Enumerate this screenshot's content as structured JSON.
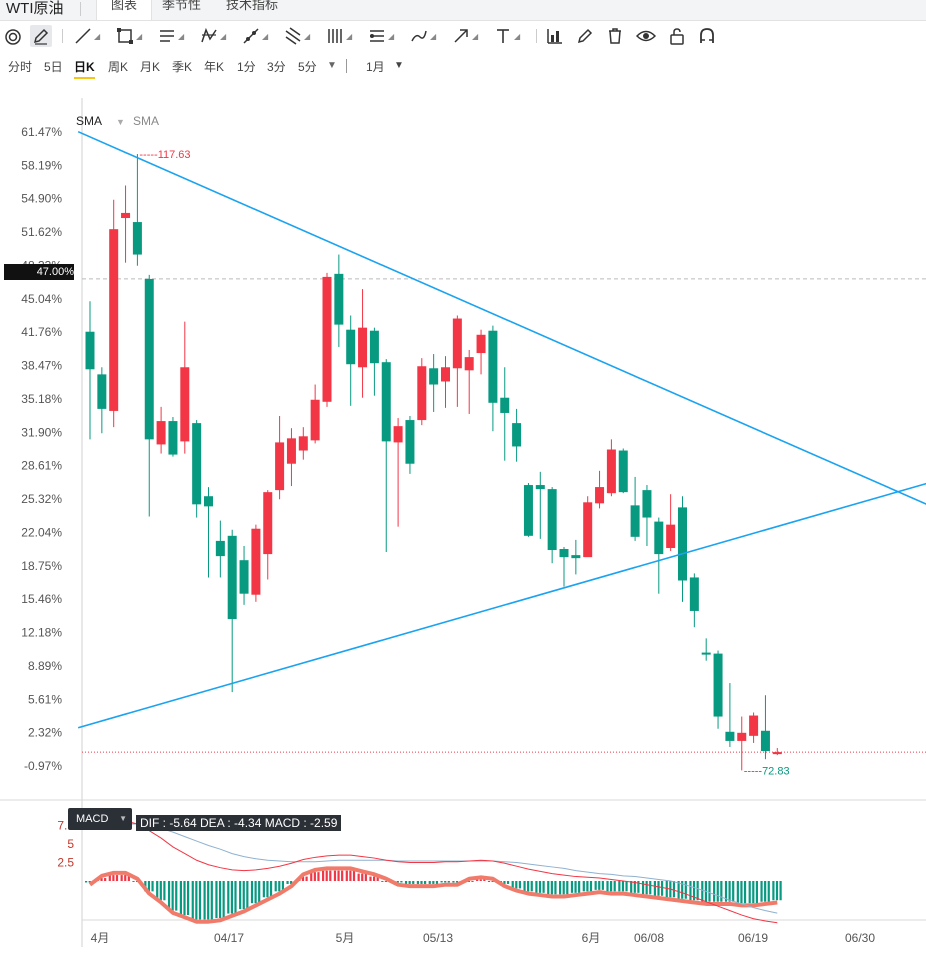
{
  "tabs": {
    "title": "WTI原油",
    "items": [
      "图表",
      "季节性",
      "技术指标"
    ],
    "active": 0
  },
  "toolbar": {
    "icons": [
      "target-icon",
      "pen-icon",
      "line-icon",
      "rect-icon",
      "hlines-icon",
      "pattern-icon",
      "crossline-icon",
      "parallel-icon",
      "fib-icon",
      "channel-icon",
      "brush-icon",
      "arrow-icon",
      "text-icon",
      "barchart-icon",
      "edit-icon",
      "trash-icon",
      "eye-icon",
      "lock-icon",
      "magnet-icon"
    ]
  },
  "periods": {
    "items": [
      "分时",
      "5日",
      "日K",
      "周K",
      "月K",
      "季K",
      "年K",
      "1分",
      "3分",
      "5分"
    ],
    "active": "日K",
    "more": "▼",
    "range": "1月",
    "range_caret": "▼"
  },
  "legend": {
    "sma1": "SMA",
    "sma2": "SMA"
  },
  "price_tag": "47.00%",
  "annotations": {
    "high": "117.63",
    "low": "72.83"
  },
  "macd": {
    "button": "MACD",
    "info": "DIF : -5.64  DEA : -4.34  MACD : -2.59",
    "ticks": [
      "7.5",
      "5",
      "2.5"
    ]
  },
  "colors": {
    "up": "#f23645",
    "down": "#089981",
    "trend": "#1aa3f0",
    "macd_hist": "#089981",
    "macd_hist_up": "#f23645",
    "macd_line": "#f07b6b",
    "dea": "#8fb1cf"
  },
  "chart_data": {
    "type": "candlestick",
    "y_axis_unit": "percent change",
    "y_ticks": [
      "61.47%",
      "58.19%",
      "54.90%",
      "51.62%",
      "48.33%",
      "45.04%",
      "41.76%",
      "38.47%",
      "35.18%",
      "31.90%",
      "28.61%",
      "25.32%",
      "22.04%",
      "18.75%",
      "15.46%",
      "12.18%",
      "8.89%",
      "5.61%",
      "2.32%",
      "-0.97%"
    ],
    "x_ticks": [
      "4月",
      "04/17",
      "5月",
      "05/13",
      "6月",
      "06/08",
      "06/19",
      "06/30"
    ],
    "candles": [
      {
        "o": 41.8,
        "c": 38.1,
        "h": 44.8,
        "l": 31.2
      },
      {
        "o": 37.6,
        "c": 34.2,
        "h": 38.3,
        "l": 31.8
      },
      {
        "o": 34.0,
        "c": 51.9,
        "h": 54.8,
        "l": 32.4
      },
      {
        "o": 53.0,
        "c": 53.5,
        "h": 56.2,
        "l": 48.6
      },
      {
        "o": 52.6,
        "c": 49.4,
        "h": 59.3,
        "l": 48.3
      },
      {
        "o": 47.0,
        "c": 31.2,
        "h": 47.4,
        "l": 23.6
      },
      {
        "o": 30.7,
        "c": 33.0,
        "h": 34.4,
        "l": 29.8
      },
      {
        "o": 33.0,
        "c": 29.7,
        "h": 33.4,
        "l": 29.5
      },
      {
        "o": 31.0,
        "c": 38.3,
        "h": 42.8,
        "l": 29.8
      },
      {
        "o": 32.8,
        "c": 24.8,
        "h": 33.1,
        "l": 23.5
      },
      {
        "o": 25.6,
        "c": 24.6,
        "h": 26.5,
        "l": 17.6
      },
      {
        "o": 21.2,
        "c": 19.7,
        "h": 23.2,
        "l": 17.6
      },
      {
        "o": 21.7,
        "c": 13.5,
        "h": 22.3,
        "l": 6.3
      },
      {
        "o": 19.3,
        "c": 16.0,
        "h": 20.7,
        "l": 14.9
      },
      {
        "o": 15.9,
        "c": 22.4,
        "h": 22.8,
        "l": 15.2
      },
      {
        "o": 19.9,
        "c": 26.0,
        "h": 26.2,
        "l": 17.4
      },
      {
        "o": 26.2,
        "c": 30.9,
        "h": 33.5,
        "l": 25.3
      },
      {
        "o": 28.8,
        "c": 31.3,
        "h": 32.3,
        "l": 26.6
      },
      {
        "o": 30.1,
        "c": 31.5,
        "h": 32.4,
        "l": 29.2
      },
      {
        "o": 31.1,
        "c": 35.1,
        "h": 36.6,
        "l": 30.8
      },
      {
        "o": 34.9,
        "c": 47.2,
        "h": 47.6,
        "l": 34.4
      },
      {
        "o": 47.5,
        "c": 42.5,
        "h": 49.4,
        "l": 40.3
      },
      {
        "o": 42.0,
        "c": 38.6,
        "h": 43.4,
        "l": 34.5
      },
      {
        "o": 38.3,
        "c": 42.2,
        "h": 46.0,
        "l": 35.3
      },
      {
        "o": 41.9,
        "c": 38.7,
        "h": 42.2,
        "l": 35.5
      },
      {
        "o": 38.8,
        "c": 31.0,
        "h": 39.1,
        "l": 20.1
      },
      {
        "o": 30.9,
        "c": 32.5,
        "h": 33.3,
        "l": 22.6
      },
      {
        "o": 33.1,
        "c": 28.8,
        "h": 33.5,
        "l": 27.8
      },
      {
        "o": 33.1,
        "c": 38.4,
        "h": 39.2,
        "l": 32.6
      },
      {
        "o": 38.2,
        "c": 36.6,
        "h": 39.6,
        "l": 33.9
      },
      {
        "o": 36.9,
        "c": 38.3,
        "h": 39.4,
        "l": 34.3
      },
      {
        "o": 38.2,
        "c": 43.1,
        "h": 43.4,
        "l": 34.4
      },
      {
        "o": 38.0,
        "c": 39.3,
        "h": 40.0,
        "l": 33.7
      },
      {
        "o": 39.7,
        "c": 41.5,
        "h": 42.0,
        "l": 37.6
      },
      {
        "o": 41.9,
        "c": 34.8,
        "h": 42.4,
        "l": 32.0
      },
      {
        "o": 35.3,
        "c": 33.8,
        "h": 38.3,
        "l": 29.1
      },
      {
        "o": 32.8,
        "c": 30.5,
        "h": 34.2,
        "l": 29.0
      },
      {
        "o": 26.7,
        "c": 21.7,
        "h": 26.9,
        "l": 21.6
      },
      {
        "o": 26.7,
        "c": 26.3,
        "h": 28.0,
        "l": 21.4
      },
      {
        "o": 26.3,
        "c": 20.3,
        "h": 26.5,
        "l": 19.0
      },
      {
        "o": 20.4,
        "c": 19.6,
        "h": 20.6,
        "l": 16.7
      },
      {
        "o": 19.8,
        "c": 19.5,
        "h": 21.3,
        "l": 17.9
      },
      {
        "o": 19.6,
        "c": 25.0,
        "h": 25.6,
        "l": 20.2
      },
      {
        "o": 24.9,
        "c": 26.5,
        "h": 28.1,
        "l": 24.4
      },
      {
        "o": 25.9,
        "c": 30.2,
        "h": 31.2,
        "l": 25.6
      },
      {
        "o": 30.1,
        "c": 26.0,
        "h": 30.3,
        "l": 25.9
      },
      {
        "o": 24.7,
        "c": 21.6,
        "h": 27.5,
        "l": 21.2
      },
      {
        "o": 26.2,
        "c": 23.5,
        "h": 26.7,
        "l": 20.7
      },
      {
        "o": 23.1,
        "c": 19.9,
        "h": 23.5,
        "l": 16.0
      },
      {
        "o": 20.5,
        "c": 22.8,
        "h": 25.8,
        "l": 20.2
      },
      {
        "o": 24.5,
        "c": 17.3,
        "h": 25.6,
        "l": 15.2
      },
      {
        "o": 17.6,
        "c": 14.3,
        "h": 18.0,
        "l": 12.7
      },
      {
        "o": 10.2,
        "c": 10.0,
        "h": 11.6,
        "l": 9.4
      },
      {
        "o": 10.1,
        "c": 3.9,
        "h": 10.4,
        "l": 2.7
      },
      {
        "o": 2.4,
        "c": 1.5,
        "h": 7.2,
        "l": 0.9
      },
      {
        "o": 1.5,
        "c": 2.3,
        "h": 3.9,
        "l": -1.4
      },
      {
        "o": 2.0,
        "c": 4.0,
        "h": 4.3,
        "l": 1.3
      },
      {
        "o": 2.5,
        "c": 0.5,
        "h": 6.0,
        "l": -0.3
      },
      {
        "o": 0.2,
        "c": 0.4,
        "h": 0.8,
        "l": 0.1
      }
    ],
    "high_label": 117.63,
    "low_label": 72.83,
    "current_level": 0.4,
    "dashed_level": 47.0,
    "trendlines": [
      {
        "from": {
          "i": -1,
          "v": 61.5
        },
        "to": {
          "i": 75.5,
          "v": 22.3
        }
      },
      {
        "from": {
          "i": -1,
          "v": 2.8
        },
        "to": {
          "i": 75.5,
          "v": 28.5
        }
      }
    ],
    "macd": {
      "dif": [
        7.2,
        7.6,
        8.0,
        8.1,
        7.7,
        6.8,
        5.8,
        4.6,
        3.7,
        2.8,
        2.2,
        1.8,
        1.5,
        1.4,
        1.5,
        1.7,
        2.0,
        2.4,
        2.9,
        3.2,
        3.4,
        3.5,
        3.5,
        3.3,
        3.1,
        2.8,
        2.6,
        2.5,
        2.5,
        2.5,
        2.6,
        2.6,
        2.7,
        2.8,
        2.7,
        2.4,
        2.0,
        1.6,
        1.3,
        1.0,
        0.8,
        0.6,
        0.5,
        0.4,
        0.2,
        0.0,
        -0.2,
        -0.5,
        -0.8,
        -1.1,
        -1.6,
        -2.2,
        -2.8,
        -3.4,
        -4.0,
        -4.6,
        -5.1,
        -5.4,
        -5.64
      ],
      "dea": [
        7.3,
        7.4,
        7.6,
        7.7,
        7.7,
        7.5,
        7.1,
        6.6,
        6.0,
        5.4,
        4.8,
        4.3,
        3.7,
        3.3,
        3.0,
        2.8,
        2.7,
        2.6,
        2.6,
        2.6,
        2.7,
        2.8,
        2.8,
        2.8,
        2.8,
        2.8,
        2.7,
        2.7,
        2.7,
        2.7,
        2.7,
        2.7,
        2.7,
        2.7,
        2.7,
        2.6,
        2.5,
        2.3,
        2.1,
        1.9,
        1.7,
        1.4,
        1.2,
        1.0,
        0.9,
        0.7,
        0.6,
        0.4,
        0.2,
        0.0,
        -0.4,
        -0.9,
        -1.4,
        -2.0,
        -2.6,
        -3.1,
        -3.6,
        -4.0,
        -4.34
      ],
      "hist": [
        -0.1,
        0.2,
        0.4,
        0.4,
        0.0,
        -0.7,
        -1.3,
        -2.0,
        -2.3,
        -2.6,
        -2.6,
        -2.5,
        -2.2,
        -1.9,
        -1.5,
        -1.1,
        -0.7,
        -0.2,
        0.3,
        0.6,
        0.7,
        0.7,
        0.7,
        0.5,
        0.3,
        0.0,
        -0.1,
        -0.2,
        -0.2,
        -0.2,
        -0.1,
        -0.1,
        0.0,
        0.1,
        0.0,
        -0.2,
        -0.5,
        -0.7,
        -0.8,
        -0.9,
        -0.9,
        -0.8,
        -0.7,
        -0.6,
        -0.7,
        -0.7,
        -0.8,
        -0.9,
        -1.0,
        -1.1,
        -1.2,
        -1.3,
        -1.4,
        -1.4,
        -1.4,
        -1.5,
        -1.5,
        -1.4,
        -1.3
      ]
    }
  }
}
